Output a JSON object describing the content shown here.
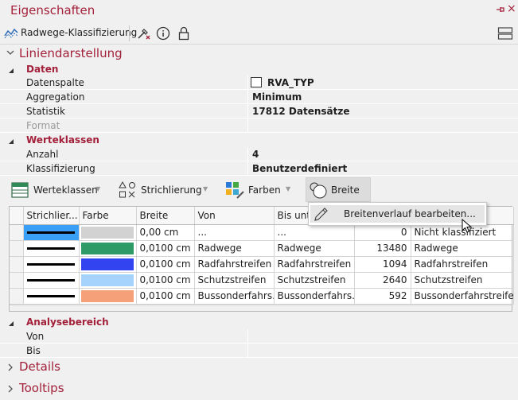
{
  "title": "Eigenschaften",
  "window_controls": {
    "pin_icon": "pin-icon",
    "close_icon": "close-icon"
  },
  "toolbar": {
    "layer_name": "Radwege-Klassifizierung"
  },
  "liniendarstellung": {
    "label": "Liniendarstellung",
    "daten": {
      "label": "Daten",
      "rows": [
        {
          "name": "Datenspalte",
          "value": "RVA_TYP"
        },
        {
          "name": "Aggregation",
          "value": "Minimum"
        },
        {
          "name": "Statistik",
          "value": "17812 Datensätze"
        },
        {
          "name": "Format",
          "value": ""
        }
      ]
    },
    "werteklassen": {
      "label": "Werteklassen",
      "rows": [
        {
          "name": "Anzahl",
          "value": "4"
        },
        {
          "name": "Klassifizierung",
          "value": "Benutzerdefiniert"
        }
      ]
    }
  },
  "class_toolbar": {
    "werteklassen": "Werteklassen",
    "strichlierung": "Strichlierung",
    "farben": "Farben",
    "breite": "Breite"
  },
  "breite_menu": {
    "item": "Breitenverlauf bearbeiten..."
  },
  "table": {
    "headers": [
      "Strichlier...",
      "Farbe",
      "Breite",
      "Von",
      "Bis unt",
      "",
      ""
    ],
    "rows": [
      {
        "color": "#d2d2d2",
        "breite": "0,00 cm",
        "von": "...",
        "bis": "...",
        "count": "0",
        "label": "Nicht klassifiziert"
      },
      {
        "color": "#2e9b66",
        "breite": "0,0100 cm",
        "von": "Radwege",
        "bis": "Radwege",
        "count": "13480",
        "label": "Radwege"
      },
      {
        "color": "#3144f0",
        "breite": "0,0100 cm",
        "von": "Radfahrstreifen",
        "bis": "Radfahrstreifen",
        "count": "1094",
        "label": "Radfahrstreifen"
      },
      {
        "color": "#a6d3fb",
        "breite": "0,0100 cm",
        "von": "Schutzstreifen",
        "bis": "Schutzstreifen",
        "count": "2640",
        "label": "Schutzstreifen"
      },
      {
        "color": "#f6a07a",
        "breite": "0,0100 cm",
        "von": "Bussonderfahrs...",
        "bis": "Bussonderfahrs...",
        "count": "592",
        "label": "Bussonderfahrstreifen"
      }
    ]
  },
  "analysebereich": {
    "label": "Analysebereich",
    "rows": [
      {
        "name": "Von",
        "value": ""
      },
      {
        "name": "Bis",
        "value": ""
      }
    ]
  },
  "details": {
    "label": "Details"
  },
  "tooltips": {
    "label": "Tooltips"
  }
}
